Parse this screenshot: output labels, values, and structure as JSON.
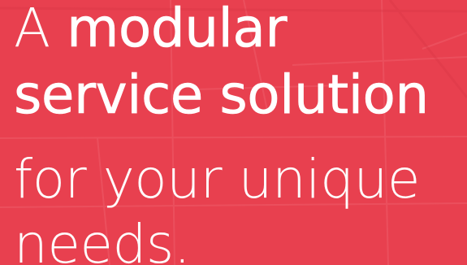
{
  "hero": {
    "line1_word1": "A",
    "line1_word2": "modular",
    "line2": "service solution",
    "line3": "for your unique",
    "line4": "needs."
  },
  "colors": {
    "background": "#e8404f",
    "text": "#ffffff"
  }
}
